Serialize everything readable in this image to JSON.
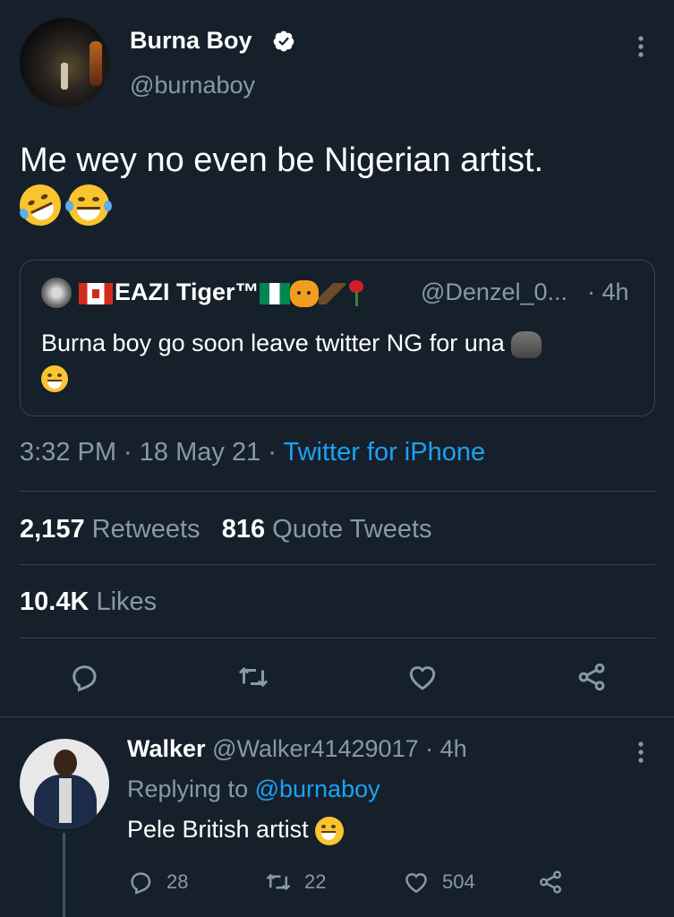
{
  "tweet": {
    "author_name": "Burna Boy",
    "author_handle": "@burnaboy",
    "text": "Me wey no even be Nigerian artist.",
    "time": "3:32 PM",
    "date": "18 May 21",
    "source": "Twitter for iPhone",
    "retweets_count": "2,157",
    "retweets_label": "Retweets",
    "quote_count": "816",
    "quote_label": "Quote Tweets",
    "likes_count": "10.4K",
    "likes_label": "Likes"
  },
  "quoted": {
    "name": "EAZI Tiger™",
    "handle": "@Denzel_0...",
    "time": "· 4h",
    "text": "Burna boy go soon leave twitter NG for una"
  },
  "reply": {
    "name": "Walker",
    "handle": "@Walker41429017",
    "time": "· 4h",
    "replying_prefix": "Replying to",
    "replying_handle": "@burnaboy",
    "text": "Pele British artist",
    "replies": "28",
    "retweets": "22",
    "likes": "504"
  },
  "colors": {
    "background": "#15202b",
    "accent": "#1da1f2",
    "muted": "#8899a6",
    "divider": "#38444d"
  },
  "icons": [
    "verified-badge-icon",
    "more-vertical-icon",
    "reply-icon",
    "retweet-icon",
    "like-icon",
    "share-icon"
  ]
}
